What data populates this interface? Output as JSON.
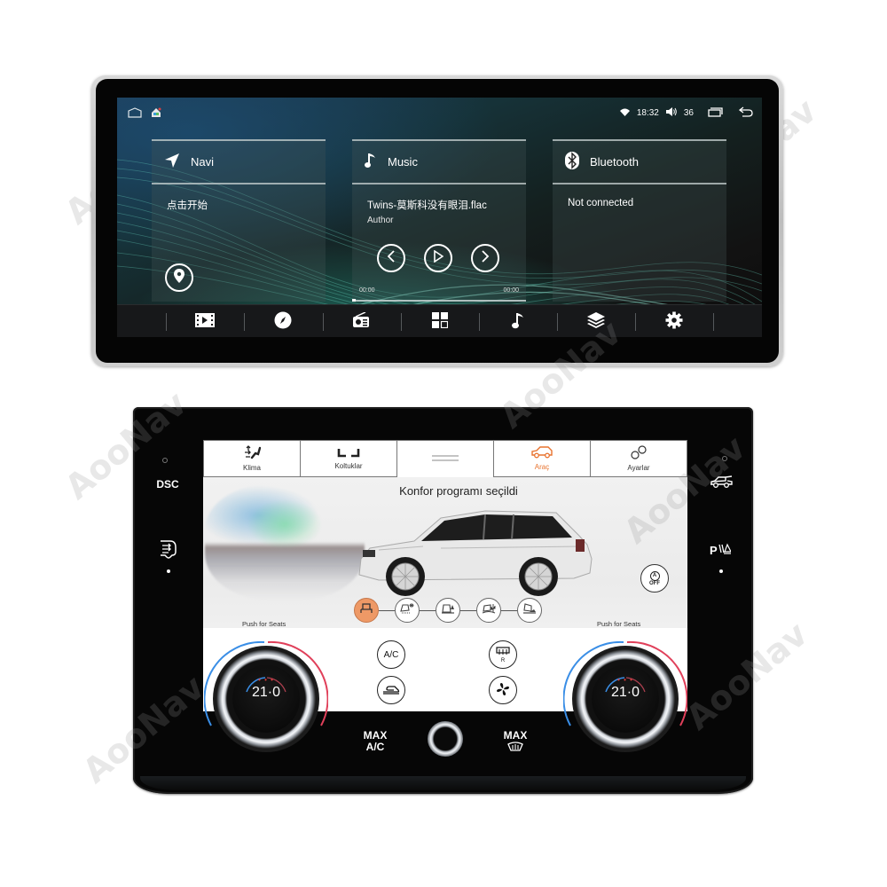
{
  "top_unit": {
    "statusbar": {
      "left_icons": [
        "home-outline-icon",
        "launcher-home-icon"
      ],
      "wifi_icon": "wifi-icon",
      "time": "18:32",
      "volume_icon": "volume-icon",
      "volume": "36",
      "recents_icon": "recent-apps-icon",
      "back_icon": "back-icon"
    },
    "cards": {
      "navi": {
        "title": "Navi",
        "icon": "navigation-arrow-icon",
        "line1": "点击开始",
        "action_icon": "map-pin-icon"
      },
      "music": {
        "title": "Music",
        "icon": "music-note-icon",
        "track": "Twins-莫斯科没有眼泪.flac",
        "artist": "Author",
        "controls": [
          "previous-icon",
          "play-icon",
          "next-icon"
        ],
        "time_elapsed": "00:00",
        "time_total": "00:00",
        "progress_fraction": 0.02
      },
      "bluetooth": {
        "title": "Bluetooth",
        "icon": "bluetooth-icon",
        "line1": "Not connected"
      }
    },
    "dock": {
      "items": [
        {
          "name": "video",
          "icon": "video-film-icon"
        },
        {
          "name": "compass",
          "icon": "compass-icon"
        },
        {
          "name": "radio",
          "icon": "radio-icon"
        },
        {
          "name": "apps",
          "icon": "apps-grid-icon"
        },
        {
          "name": "music",
          "icon": "music-note-icon"
        },
        {
          "name": "layers",
          "icon": "layers-icon"
        },
        {
          "name": "settings",
          "icon": "gear-icon"
        }
      ]
    }
  },
  "bottom_unit": {
    "tabs": [
      {
        "label": "Klima",
        "icon": "climate-airflow-icon"
      },
      {
        "label": "Koltuklar",
        "icon": "seats-icon"
      },
      {
        "label": "",
        "icon": "menu-handle-icon"
      },
      {
        "label": "Araç",
        "icon": "car-icon",
        "selected": true
      },
      {
        "label": "Ayarlar",
        "icon": "settings-circles-icon"
      }
    ],
    "scene_title": "Konfor programı seçildi",
    "auto_off": {
      "label_top": "A",
      "label_bottom": "OFF"
    },
    "terrain_modes": [
      {
        "name": "comfort",
        "icon": "seat-comfort-icon",
        "active": true
      },
      {
        "name": "grass-gravel-snow",
        "icon": "snow-mode-icon",
        "active": false
      },
      {
        "name": "mud-ruts",
        "icon": "mud-mode-icon",
        "active": false
      },
      {
        "name": "sand",
        "icon": "sand-mode-icon",
        "active": false
      },
      {
        "name": "rock-crawl",
        "icon": "rock-mode-icon",
        "active": false
      }
    ],
    "push_for_seats_left": "Push for Seats",
    "push_for_seats_right": "Push for Seats",
    "climate_buttons": {
      "ac": "A/C",
      "rear_defrost_label": "R",
      "recirculation_icon": "recirculation-icon",
      "fan_icon": "fan-icon"
    },
    "left_temp": "21·0",
    "right_temp": "21·0",
    "temp_dots": "• • •",
    "bezel": {
      "dsc": "DSC",
      "left_lower_icon": "airflow-face-icon",
      "right_upper_icon": "car-hatch-icon",
      "right_lower_label": "P",
      "max_ac_line1": "MAX",
      "max_ac_line2": "A/C",
      "max_defrost_line1": "MAX",
      "max_defrost_icon": "front-defrost-icon"
    },
    "colors": {
      "accent_orange": "#e8732f",
      "active_mode": "#ee9966",
      "cold": "#3a8ee6",
      "hot": "#e0405a"
    }
  },
  "watermark": "AooNav"
}
